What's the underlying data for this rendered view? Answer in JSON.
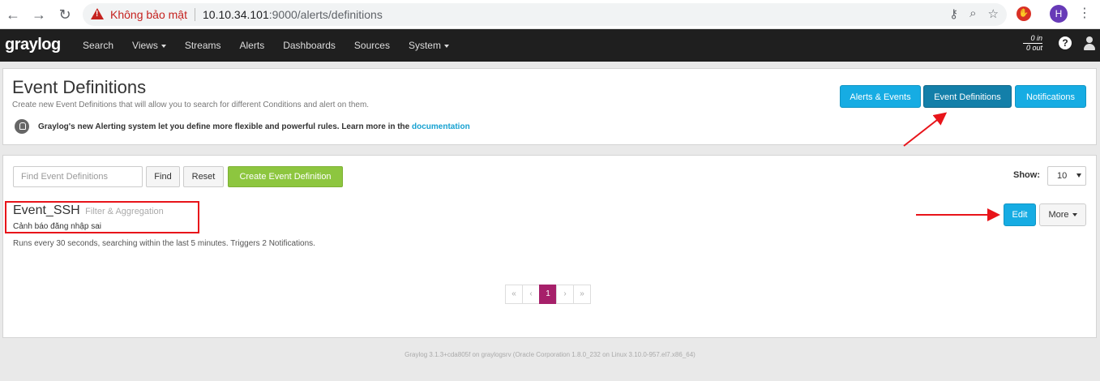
{
  "browser": {
    "security_label": "Không bảo mật",
    "url_host": "10.10.34.101",
    "url_path": ":9000/alerts/definitions",
    "profile_initial": "H"
  },
  "nav": {
    "logo": "graylog",
    "items": [
      {
        "label": "Search",
        "dropdown": false
      },
      {
        "label": "Views",
        "dropdown": true
      },
      {
        "label": "Streams",
        "dropdown": false
      },
      {
        "label": "Alerts",
        "dropdown": false
      },
      {
        "label": "Dashboards",
        "dropdown": false
      },
      {
        "label": "Sources",
        "dropdown": false
      },
      {
        "label": "System",
        "dropdown": true
      }
    ],
    "throughput_in": "0 in",
    "throughput_out": "0 out",
    "help": "?"
  },
  "header": {
    "title": "Event Definitions",
    "description": "Create new Event Definitions that will allow you to search for different Conditions and alert on them.",
    "notice": "Graylog's new Alerting system let you define more flexible and powerful rules. Learn more in the ",
    "notice_link": "documentation",
    "buttons": {
      "alerts_events": "Alerts & Events",
      "event_definitions": "Event Definitions",
      "notifications": "Notifications"
    }
  },
  "toolbar": {
    "search_placeholder": "Find Event Definitions",
    "find_label": "Find",
    "reset_label": "Reset",
    "create_label": "Create Event Definition",
    "show_label": "Show:",
    "show_value": "10"
  },
  "event": {
    "name": "Event_SSH",
    "type": "Filter & Aggregation",
    "description": "Cảnh báo đăng nhập sai",
    "summary": "Runs every 30 seconds, searching within the last 5 minutes. Triggers 2 Notifications.",
    "edit_label": "Edit",
    "more_label": "More"
  },
  "pagination": {
    "first": "«",
    "prev": "‹",
    "current": "1",
    "next": "›",
    "last": "»"
  },
  "footer": {
    "text": "Graylog 3.1.3+cda805f on graylogsrv (Oracle Corporation 1.8.0_232 on Linux 3.10.0-957.el7.x86_64)"
  },
  "colors": {
    "navbar": "#1f1f1f",
    "info": "#16ace3",
    "success": "#8dc63f",
    "pagination_active": "#a6206a",
    "annotation": "#e8141a"
  }
}
